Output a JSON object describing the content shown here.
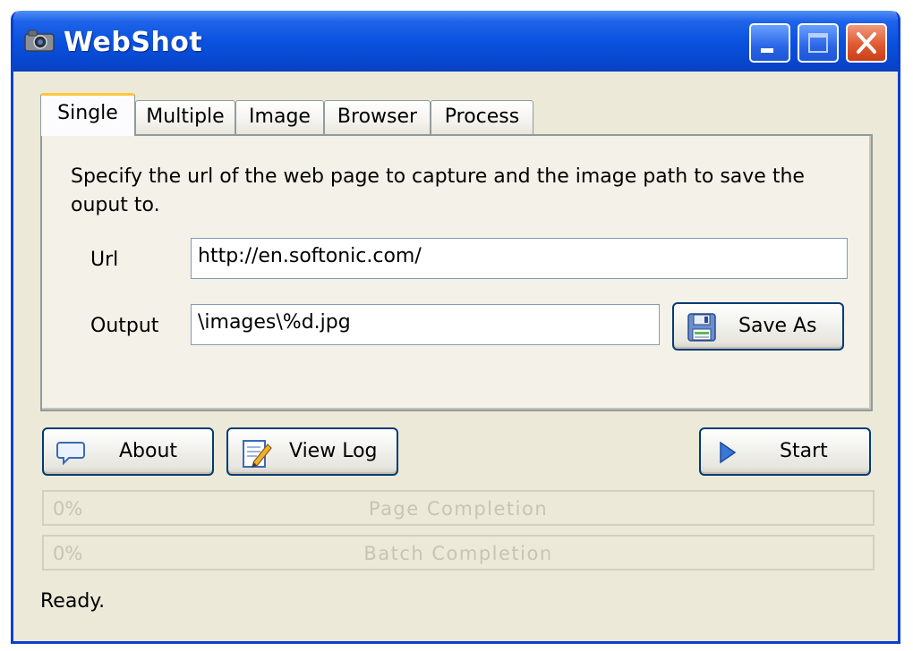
{
  "window": {
    "title": "WebShot"
  },
  "tabs": [
    {
      "label": "Single",
      "active": true
    },
    {
      "label": "Multiple",
      "active": false
    },
    {
      "label": "Image",
      "active": false
    },
    {
      "label": "Browser",
      "active": false
    },
    {
      "label": "Process",
      "active": false
    }
  ],
  "single": {
    "description": "Specify the url of the web page to capture and the image path to save the ouput to.",
    "url_label": "Url",
    "url_value": "http://en.softonic.com/",
    "output_label": "Output",
    "output_value": "\\images\\%d.jpg",
    "save_as_label": "Save As"
  },
  "actions": {
    "about_label": "About",
    "view_log_label": "View Log",
    "start_label": "Start"
  },
  "progress": {
    "page": {
      "percent_text": "0%",
      "label": "Page Completion",
      "value": 0
    },
    "batch": {
      "percent_text": "0%",
      "label": "Batch Completion",
      "value": 0
    }
  },
  "status": {
    "text": "Ready."
  },
  "icons": {
    "app": "camera-icon",
    "save": "floppy-disk-icon",
    "about": "speech-bubble-icon",
    "view_log": "notepad-pencil-icon",
    "start": "play-icon"
  },
  "colors": {
    "titlebar": "#0a52e0",
    "window_bg": "#ece9d8",
    "button_border": "#003c74",
    "active_tab_accent": "#ffc83c"
  }
}
